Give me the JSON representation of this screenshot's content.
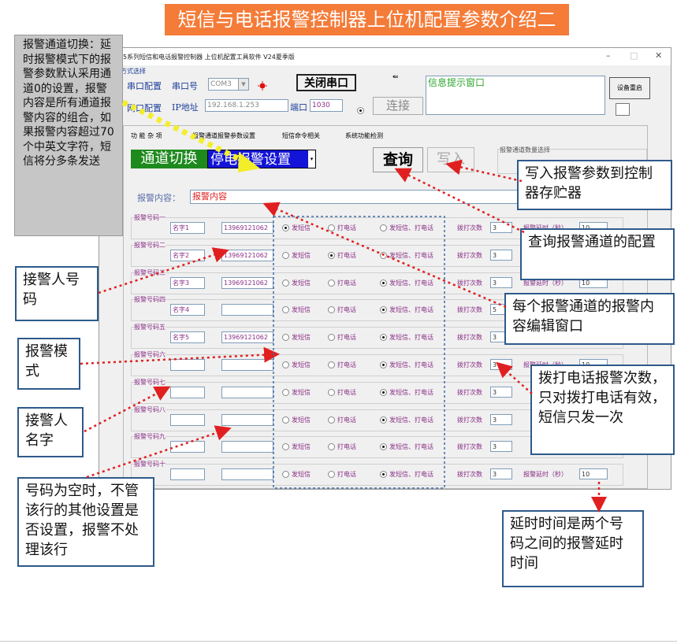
{
  "slide": {
    "title": "短信与电话报警控制器上位机配置参数介绍二"
  },
  "window": {
    "title": "5系列短信和电话报警控制器 上位机配置工具软件 V24夏季版",
    "minimize": "–",
    "maximize": "□",
    "close": "✕",
    "conn_section": "方式选择",
    "serial_label": "串口配置",
    "serial_port_label": "串口号",
    "serial_port_value": "COM3",
    "close_port_button": "关闭串口",
    "net_label": "网口配置",
    "ip_label": "IP地址",
    "ip_value": "192.168.1.253",
    "port_label": "端口",
    "port_value": "1030",
    "connect_button": "连接",
    "info_window_label": "信息提示窗口",
    "reset_button": "设备重启",
    "tabs": [
      "功 能 杂 项",
      "报警通道报警参数设置",
      "短信命令相关",
      "系统功能检测"
    ],
    "channel_toggle": "通道切换",
    "channel_select": "停电报警设置",
    "query_button": "查询",
    "write_button": "写入",
    "channel_count_label": "报警通道数量选择",
    "alarm_content_label": "报警内容：",
    "alarm_content_value": "报警内容",
    "rows": [
      {
        "group": "报警号码一",
        "name": "名字1",
        "number": "13969121062",
        "mode": 0,
        "dial_count": "3",
        "delay_label": "报警延时（秒）",
        "delay": "10"
      },
      {
        "group": "报警号码二",
        "name": "名字2",
        "number": "13969121062",
        "mode": 1,
        "dial_count": "3",
        "delay_label": "",
        "delay": ""
      },
      {
        "group": "报警号码三",
        "name": "名字3",
        "number": "13969121062",
        "mode": 2,
        "dial_count": "3",
        "delay_label": "报警延时（秒）",
        "delay": "10"
      },
      {
        "group": "报警号码四",
        "name": "名字4",
        "number": "",
        "mode": 2,
        "dial_count": "5",
        "delay_label": "",
        "delay": ""
      },
      {
        "group": "报警号码五",
        "name": "名字5",
        "number": "13969121062",
        "mode": 2,
        "dial_count": "3",
        "delay_label": "",
        "delay": ""
      },
      {
        "group": "报警号码六",
        "name": "",
        "number": "",
        "mode": 2,
        "dial_count": "3",
        "delay_label": "报警延时（秒）",
        "delay": "10"
      },
      {
        "group": "报警号码七",
        "name": "",
        "number": "",
        "mode": 2,
        "dial_count": "3",
        "delay_label": "",
        "delay": ""
      },
      {
        "group": "报警号码八",
        "name": "",
        "number": "",
        "mode": 2,
        "dial_count": "3",
        "delay_label": "",
        "delay": ""
      },
      {
        "group": "报警号码九",
        "name": "",
        "number": "",
        "mode": 2,
        "dial_count": "3",
        "delay_label": "",
        "delay": ""
      },
      {
        "group": "报警号码十",
        "name": "",
        "number": "",
        "mode": 2,
        "dial_count": "3",
        "delay_label": "报警延时（秒）",
        "delay": "10"
      }
    ],
    "mode_labels": [
      "发短信",
      "打电话",
      "发短信、打电话"
    ],
    "dial_label": "拨打次数"
  },
  "callouts": {
    "gray_note": "报警通道切换：延时报警模式下的报警参数默认采用通道0的设置，报警内容是所有通道报警内容的组合，如果报警内容超过70个中英文字符，短信将分多条发送",
    "write": "写入报警参数到控制器存贮器",
    "query": "查询报警通道的配置",
    "content_window": "每个报警通道的报警内容编辑窗口",
    "receiver_number": "接警人号码",
    "alarm_mode": "报警模式",
    "receiver_name": "接警人名字",
    "dial_count": "拨打电话报警次数，只对拨打电话有效，短信只发一次",
    "empty_number": "号码为空时，不管该行的其他设置是否设置，报警不处理该行",
    "delay": "延时时间是两个号码之间的报警延时时间"
  },
  "colors": {
    "accent_orange": "#f47b38",
    "callout_border": "#2e5a8a",
    "arrow_red": "#e02020",
    "highlight_yellow": "#f2ee2a",
    "channel_green": "#1e8a1e",
    "channel_blue": "#1414d8"
  }
}
